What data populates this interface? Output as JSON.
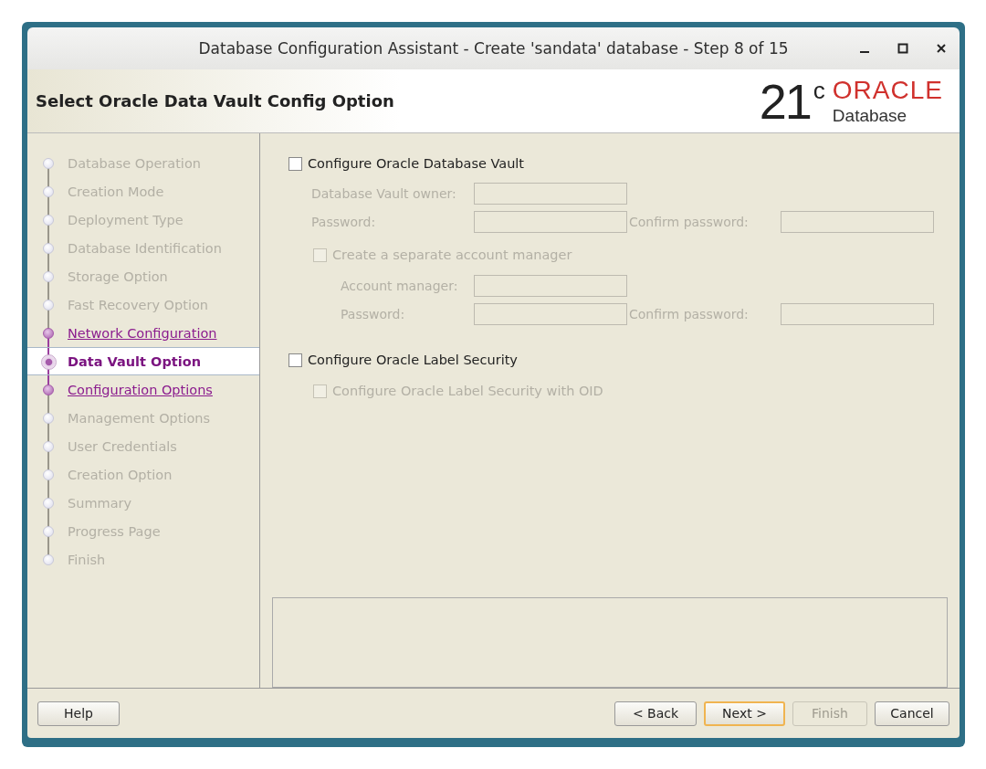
{
  "window": {
    "title": "Database Configuration Assistant - Create 'sandata' database - Step 8 of 15"
  },
  "header": {
    "title": "Select Oracle Data Vault Config Option",
    "version": "21",
    "version_sup": "c",
    "brand": "ORACLE",
    "product": "Database"
  },
  "steps": [
    {
      "label": "Database Operation",
      "kind": "pending",
      "selected": false
    },
    {
      "label": "Creation Mode",
      "kind": "pending",
      "selected": false
    },
    {
      "label": "Deployment Type",
      "kind": "pending",
      "selected": false
    },
    {
      "label": "Database Identification",
      "kind": "pending",
      "selected": false
    },
    {
      "label": "Storage Option",
      "kind": "pending",
      "selected": false
    },
    {
      "label": "Fast Recovery Option",
      "kind": "pending",
      "selected": false
    },
    {
      "label": "Network Configuration",
      "kind": "link",
      "selected": false
    },
    {
      "label": "Data Vault Option",
      "kind": "current",
      "selected": true
    },
    {
      "label": "Configuration Options",
      "kind": "link",
      "selected": false
    },
    {
      "label": "Management Options",
      "kind": "pending",
      "selected": false
    },
    {
      "label": "User Credentials",
      "kind": "pending",
      "selected": false
    },
    {
      "label": "Creation Option",
      "kind": "pending",
      "selected": false
    },
    {
      "label": "Summary",
      "kind": "pending",
      "selected": false
    },
    {
      "label": "Progress Page",
      "kind": "pending",
      "selected": false
    },
    {
      "label": "Finish",
      "kind": "pending",
      "selected": false
    }
  ],
  "vault": {
    "label": "Configure Oracle Database Vault",
    "checked": false,
    "disabled": false,
    "owner": {
      "label": "Database Vault owner:",
      "disabled": true
    },
    "password": {
      "label": "Password:",
      "disabled": true
    },
    "confirm": {
      "label": "Confirm password:",
      "disabled": true
    },
    "separate": {
      "label": "Create a separate account manager",
      "checked": false,
      "disabled": true
    },
    "manager": {
      "label": "Account manager:",
      "disabled": true
    },
    "manager_password": {
      "label": "Password:",
      "disabled": true
    },
    "manager_confirm": {
      "label": "Confirm password:",
      "disabled": true
    }
  },
  "label_security": {
    "label": "Configure Oracle Label Security",
    "checked": false,
    "disabled": false,
    "oid": {
      "label": "Configure Oracle Label Security with OID",
      "checked": false,
      "disabled": true
    }
  },
  "buttons": [
    {
      "label": "Help",
      "disabled": false,
      "selected": false
    },
    {
      "label": "< Back",
      "disabled": false,
      "selected": false
    },
    {
      "label": "Next >",
      "disabled": false,
      "selected": true
    },
    {
      "label": "Finish",
      "disabled": true,
      "selected": false
    },
    {
      "label": "Cancel",
      "disabled": false,
      "selected": false
    }
  ]
}
